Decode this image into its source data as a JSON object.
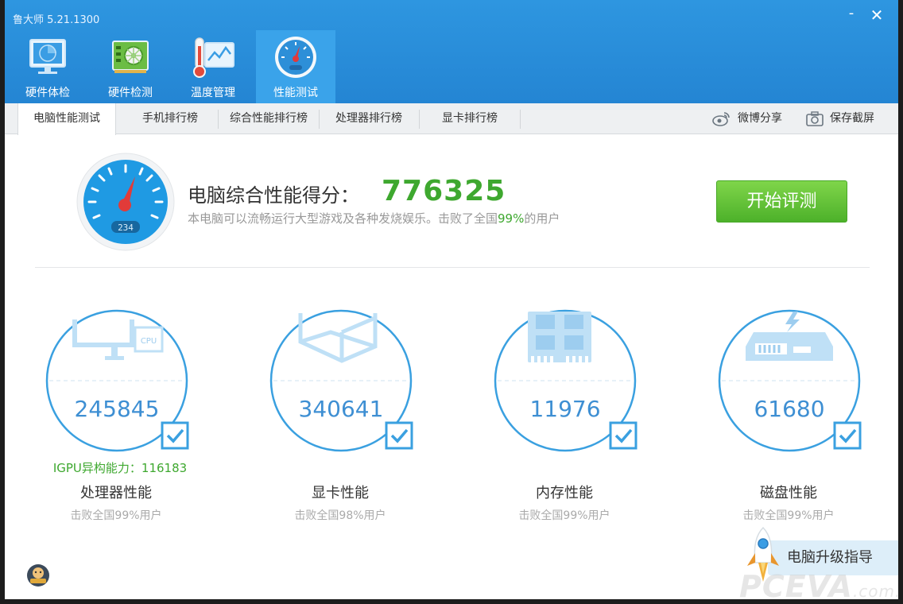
{
  "app": {
    "title": "鲁大师 5.21.1300",
    "minimize": "-",
    "close": "✕"
  },
  "nav": {
    "tabs": [
      {
        "label": "硬件体检",
        "icon": "monitor-radar-icon"
      },
      {
        "label": "硬件检测",
        "icon": "graphics-card-icon"
      },
      {
        "label": "温度管理",
        "icon": "thermometer-chart-icon"
      },
      {
        "label": "性能测试",
        "icon": "speedometer-icon",
        "active": true
      }
    ]
  },
  "subtabs": {
    "items": [
      {
        "label": "电脑性能测试",
        "active": true
      },
      {
        "label": "手机排行榜"
      },
      {
        "label": "综合性能排行榜"
      },
      {
        "label": "处理器排行榜"
      },
      {
        "label": "显卡排行榜"
      }
    ],
    "share_label": "微博分享",
    "screenshot_label": "保存截屏"
  },
  "score": {
    "gauge_readout": "234",
    "label": "电脑综合性能得分：",
    "value": "776325",
    "desc_prefix": "本电脑可以流畅运行大型游戏及各种发烧娱乐。击败了全国",
    "desc_percent": "99%",
    "desc_suffix": "的用户",
    "start_button": "开始评测"
  },
  "cards": [
    {
      "value": "245845",
      "extra": "IGPU异构能力：116183",
      "name": "处理器性能",
      "rank": "击败全国99%用户",
      "icon": "cpu-monitor-icon",
      "cpu_text": "CPU"
    },
    {
      "value": "340641",
      "name": "显卡性能",
      "rank": "击败全国98%用户",
      "icon": "graphics-cube-icon"
    },
    {
      "value": "11976",
      "name": "内存性能",
      "rank": "击败全国99%用户",
      "icon": "memory-chip-icon"
    },
    {
      "value": "61680",
      "name": "磁盘性能",
      "rank": "击败全国99%用户",
      "icon": "disk-drive-icon"
    }
  ],
  "footer": {
    "upgrade_label": "电脑升级指导",
    "watermark": "PCEVA",
    "watermark_domain": ".com.cn"
  },
  "colors": {
    "accent": "#2e96e0",
    "score_green": "#3ea82f",
    "metric_blue": "#3e8fd3",
    "button_green": "#5cbf35"
  }
}
